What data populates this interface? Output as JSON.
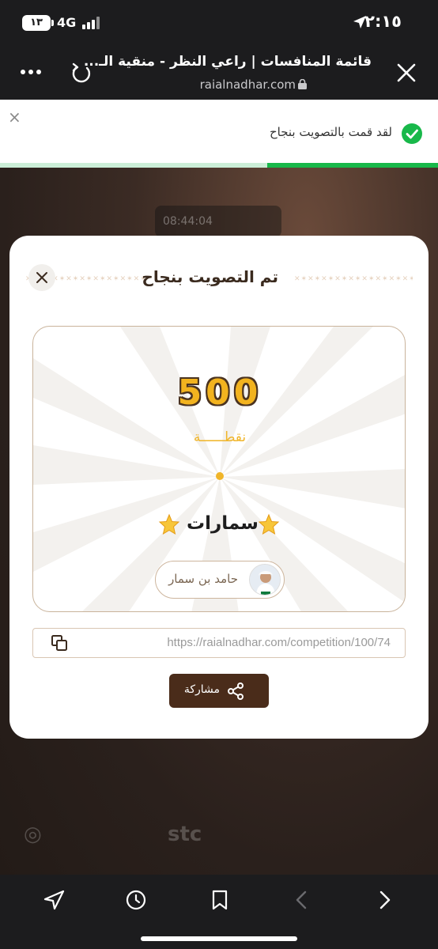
{
  "status_bar": {
    "time": "٢:١٥",
    "battery": "١٣",
    "network": "4G"
  },
  "browser": {
    "page_title": "قائمة المنافسات | راعي النظر - منقية الـ...",
    "url": "raialnadhar.com"
  },
  "toast": {
    "message": "لقد قمت بالتصويت بنجاح",
    "close_symbol": "×",
    "progress": 0.39,
    "accent_color": "#18b84a"
  },
  "modal": {
    "title": "تم التصويت بنجاح",
    "score": "500",
    "score_unit": "نقطــــــة",
    "entry_name": "سمارات",
    "owner_name": "حامد بن سمار",
    "share_link": "https://raialnadhar.com/competition/100/74",
    "share_label": "مشاركة",
    "accent_color": "#4a2c1a"
  },
  "background": {
    "timer": "08:44:04"
  },
  "icons": [
    "location-arrow-icon",
    "signal-icon",
    "close-icon",
    "reload-icon",
    "more-icon",
    "lock-icon",
    "check-icon",
    "star-icon",
    "copy-icon",
    "share-icon",
    "back-icon",
    "history-icon",
    "bookmark-icon",
    "nav-back-icon",
    "nav-forward-icon"
  ]
}
